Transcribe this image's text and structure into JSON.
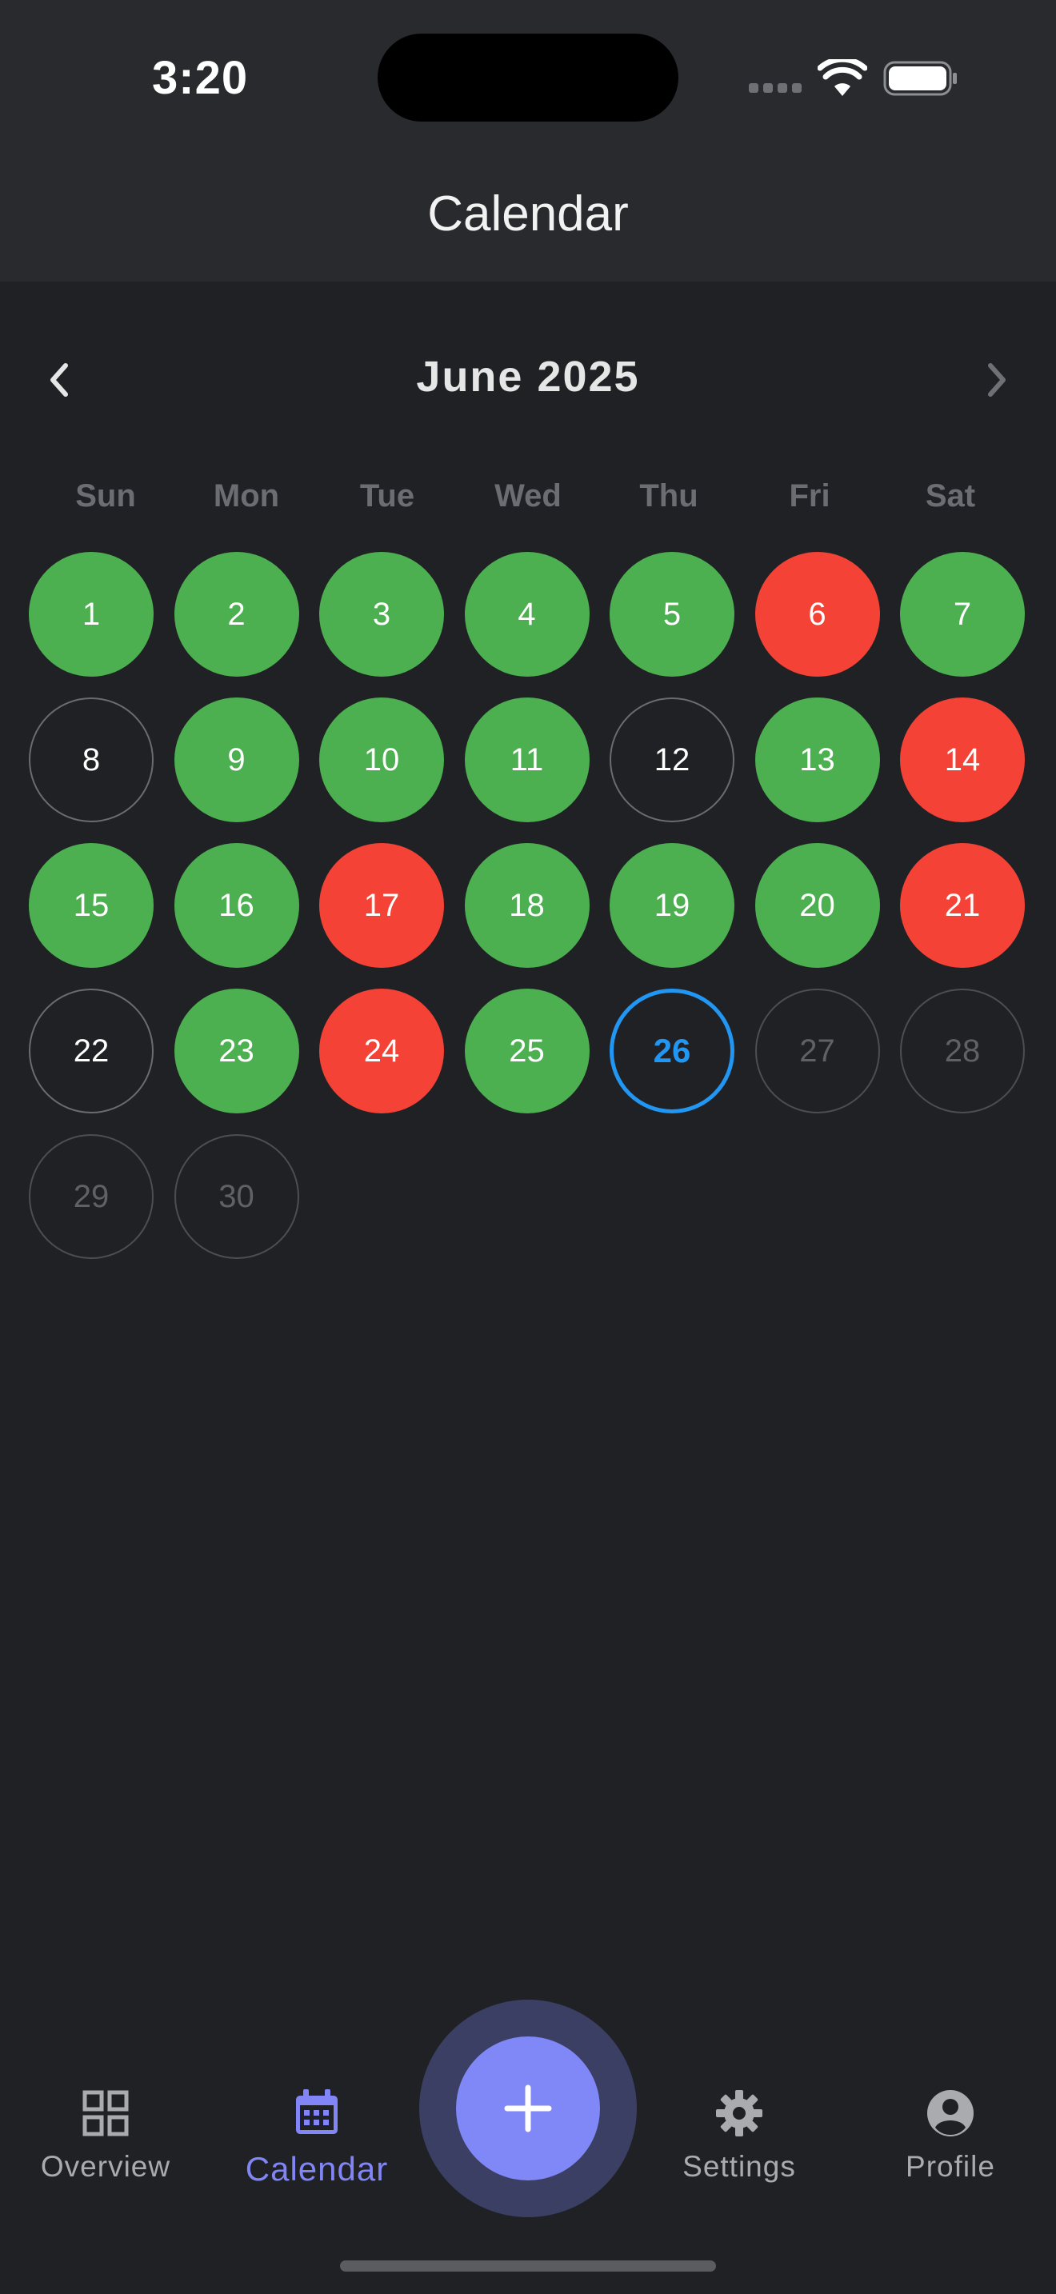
{
  "status_bar": {
    "time": "3:20"
  },
  "header": {
    "title": "Calendar"
  },
  "month_nav": {
    "title": "June 2025",
    "prev_icon": "chevron-left-icon",
    "next_icon": "chevron-right-icon"
  },
  "weekdays": [
    "Sun",
    "Mon",
    "Tue",
    "Wed",
    "Thu",
    "Fri",
    "Sat"
  ],
  "legend_colors": {
    "success": "#4caf50",
    "fail": "#f44336",
    "today": "#2196f3",
    "accent": "#8087f6"
  },
  "days": [
    {
      "label": "1",
      "status": "success"
    },
    {
      "label": "2",
      "status": "success"
    },
    {
      "label": "3",
      "status": "success"
    },
    {
      "label": "4",
      "status": "success"
    },
    {
      "label": "5",
      "status": "success"
    },
    {
      "label": "6",
      "status": "fail"
    },
    {
      "label": "7",
      "status": "success"
    },
    {
      "label": "8",
      "status": "empty"
    },
    {
      "label": "9",
      "status": "success"
    },
    {
      "label": "10",
      "status": "success"
    },
    {
      "label": "11",
      "status": "success"
    },
    {
      "label": "12",
      "status": "empty"
    },
    {
      "label": "13",
      "status": "success"
    },
    {
      "label": "14",
      "status": "fail"
    },
    {
      "label": "15",
      "status": "success"
    },
    {
      "label": "16",
      "status": "success"
    },
    {
      "label": "17",
      "status": "fail"
    },
    {
      "label": "18",
      "status": "success"
    },
    {
      "label": "19",
      "status": "success"
    },
    {
      "label": "20",
      "status": "success"
    },
    {
      "label": "21",
      "status": "fail"
    },
    {
      "label": "22",
      "status": "empty"
    },
    {
      "label": "23",
      "status": "success"
    },
    {
      "label": "24",
      "status": "fail"
    },
    {
      "label": "25",
      "status": "success"
    },
    {
      "label": "26",
      "status": "today"
    },
    {
      "label": "27",
      "status": "future"
    },
    {
      "label": "28",
      "status": "future"
    },
    {
      "label": "29",
      "status": "future"
    },
    {
      "label": "30",
      "status": "future"
    }
  ],
  "bottom_nav": {
    "overview": {
      "label": "Overview",
      "icon": "grid-icon"
    },
    "calendar": {
      "label": "Calendar",
      "icon": "calendar-icon"
    },
    "settings": {
      "label": "Settings",
      "icon": "gear-icon"
    },
    "profile": {
      "label": "Profile",
      "icon": "account-circle-icon"
    },
    "add": {
      "icon": "plus-icon"
    }
  }
}
